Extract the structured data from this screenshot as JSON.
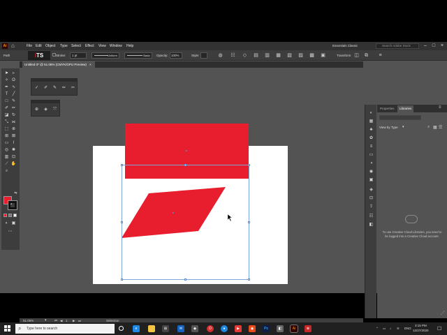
{
  "app": {
    "logo": "Ai",
    "menus": [
      "File",
      "Edit",
      "Object",
      "Type",
      "Select",
      "Effect",
      "View",
      "Window",
      "Help"
    ],
    "workspace": "Essentials Classic",
    "search_placeholder": "Search Adobe Stock"
  },
  "control_bar": {
    "selection_label": "Path",
    "stroke_label": "Stroke:",
    "stroke_value": "1 pt",
    "profile_value": "Uniform",
    "brush_value": "Basic",
    "opacity_label": "Opacity:",
    "opacity_value": "100%",
    "style_label": "Style:",
    "transform_label": "Transform"
  },
  "document": {
    "tab_title": "Untitled-3* @ 51.06% (CMYK/GPU Preview)",
    "close_glyph": "×"
  },
  "colors": {
    "fill": "#e81e2f",
    "ui_bg": "#535353",
    "panel_bg": "#3d3d3d",
    "selection": "#7ba6d6"
  },
  "canvas": {
    "shapes": [
      {
        "name": "rectangle",
        "fill": "#e81e2f"
      },
      {
        "name": "parallelogram",
        "fill": "#e81e2f"
      }
    ]
  },
  "libraries_panel": {
    "tabs": [
      "Properties",
      "Libraries"
    ],
    "active_tab": "Libraries",
    "view_by": "View by Type",
    "message": "To use Creative Cloud Libraries, you need to be logged into a Creative Cloud account."
  },
  "status_bar": {
    "zoom": "51.06%",
    "page": "1",
    "tool": "Selection"
  },
  "taskbar": {
    "search_placeholder": "Type here to search",
    "time": "3:15 PM",
    "date": "12/27/2020",
    "language": "ENG"
  }
}
